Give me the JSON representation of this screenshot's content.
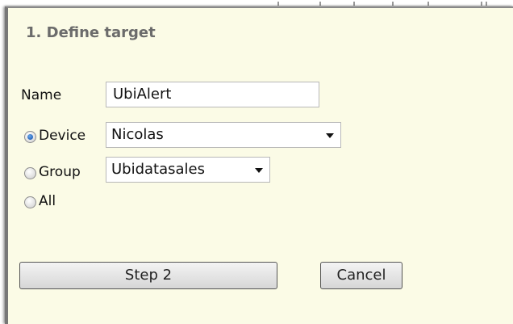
{
  "form": {
    "title": "1. Define target",
    "name_label": "Name",
    "name_value": "UbiAlert",
    "options": [
      {
        "label": "Device",
        "checked": true,
        "select_value": "Nicolas"
      },
      {
        "label": "Group",
        "checked": false,
        "select_value": "Ubidatasales"
      },
      {
        "label": "All",
        "checked": false
      }
    ]
  },
  "buttons": {
    "step2": "Step 2",
    "cancel": "Cancel"
  },
  "icons": {
    "radio_selected": "radio-selected-icon",
    "radio_unselected": "radio-unselected-icon",
    "dropdown": "chevron-down-icon"
  },
  "colors": {
    "panel_background": "#fbfbe6",
    "title_text": "#6b6b6b",
    "radio_selected": "#1f5fb8"
  }
}
